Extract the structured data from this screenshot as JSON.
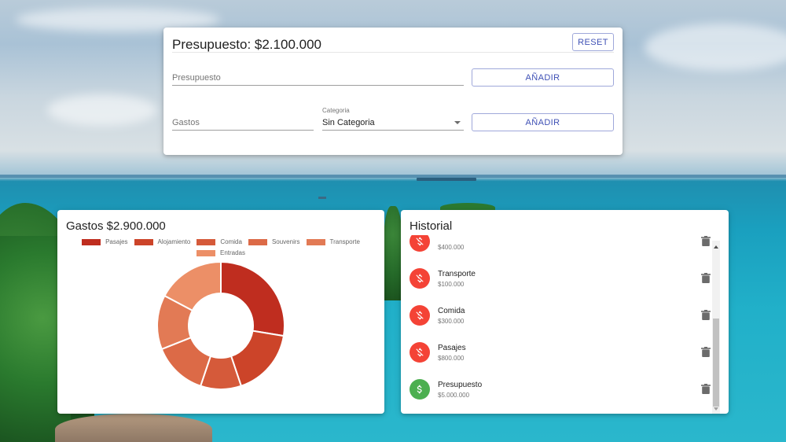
{
  "budget_panel": {
    "title": "Presupuesto: $2.100.000",
    "reset_label": "RESET",
    "budget_input": {
      "placeholder": "Presupuesto",
      "value": ""
    },
    "budget_add_label": "AÑADIR",
    "expense_input": {
      "placeholder": "Gastos",
      "value": ""
    },
    "category_select": {
      "label": "Categoria",
      "value": "Sin Categoria"
    },
    "expense_add_label": "AÑADIR",
    "button_color": "#3f51b5"
  },
  "expenses_panel": {
    "title": "Gastos $2.900.000",
    "chart_data": {
      "type": "pie",
      "donut": true,
      "categories": [
        "Pasajes",
        "Alojamiento",
        "Comida",
        "Souvenirs",
        "Transporte",
        "Entradas"
      ],
      "values": [
        800000,
        500000,
        300000,
        400000,
        400000,
        500000
      ],
      "colors": [
        "#bf2d1f",
        "#cc4429",
        "#d55a3a",
        "#dc6a47",
        "#e27a55",
        "#ec8f67"
      ],
      "legend_position": "top"
    }
  },
  "history_panel": {
    "title": "Historial",
    "items": [
      {
        "name": "",
        "amount": "$400.000",
        "kind": "expense",
        "icon": "money-off-icon"
      },
      {
        "name": "Transporte",
        "amount": "$100.000",
        "kind": "expense",
        "icon": "money-off-icon"
      },
      {
        "name": "Comida",
        "amount": "$300.000",
        "kind": "expense",
        "icon": "money-off-icon"
      },
      {
        "name": "Pasajes",
        "amount": "$800.000",
        "kind": "expense",
        "icon": "money-off-icon"
      },
      {
        "name": "Presupuesto",
        "amount": "$5.000.000",
        "kind": "income",
        "icon": "money-icon"
      }
    ],
    "colors": {
      "expense": "#f44336",
      "income": "#4caf50"
    },
    "delete_icon": "trash-icon"
  }
}
